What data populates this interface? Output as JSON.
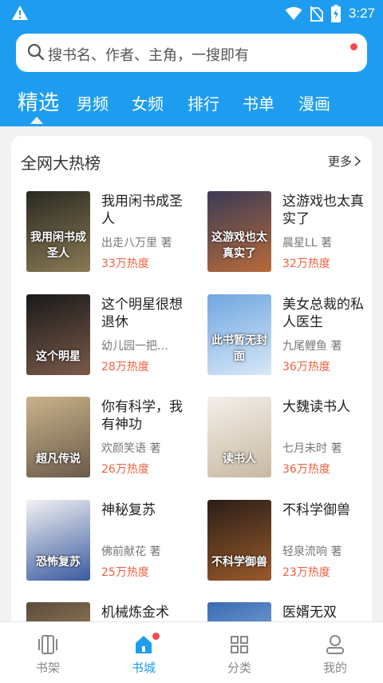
{
  "status": {
    "time": "3:27"
  },
  "search": {
    "placeholder": "搜书名、作者、主角，一搜即有"
  },
  "tabs": [
    {
      "label": "精选"
    },
    {
      "label": "男频"
    },
    {
      "label": "女频"
    },
    {
      "label": "排行"
    },
    {
      "label": "书单"
    },
    {
      "label": "漫画"
    }
  ],
  "section": {
    "title": "全网大热榜",
    "more": "更多"
  },
  "books": [
    {
      "title": "我用闲书成圣人",
      "author": "出走八万里 著",
      "heat": "33万热度",
      "cover_text": "我用闲书成圣人",
      "cover_colors": [
        "#2a2a22",
        "#8a7a55"
      ]
    },
    {
      "title": "这游戏也太真实了",
      "author": "晨星LL 著",
      "heat": "32万热度",
      "cover_text": "这游戏也太真实了",
      "cover_colors": [
        "#3b3b55",
        "#b86a3a"
      ]
    },
    {
      "title": "这个明星很想退休",
      "author": "幼儿园一把…",
      "heat": "28万热度",
      "cover_text": "这个明星",
      "cover_colors": [
        "#1a1a1a",
        "#7a5a4a"
      ]
    },
    {
      "title": "美女总裁的私人医生",
      "author": "九尾鲤鱼 著",
      "heat": "36万热度",
      "cover_text": "此书暂无封面",
      "cover_colors": [
        "#6fa6e0",
        "#d8e8f8"
      ]
    },
    {
      "title": "你有科学，我有神功",
      "author": "欢颜笑语 著",
      "heat": "26万热度",
      "cover_text": "超凡传说",
      "cover_colors": [
        "#c9b38a",
        "#6a5a4a"
      ]
    },
    {
      "title": "大魏读书人",
      "author": "七月未时 著",
      "heat": "36万热度",
      "cover_text": "读书人",
      "cover_colors": [
        "#f4f0ea",
        "#c8b8a0"
      ]
    },
    {
      "title": "神秘复苏",
      "author": "佛前献花 著",
      "heat": "25万热度",
      "cover_text": "恐怖复苏",
      "cover_colors": [
        "#f2f2f2",
        "#3a5aa0"
      ]
    },
    {
      "title": "不科学御兽",
      "author": "轻泉流响 著",
      "heat": "23万热度",
      "cover_text": "不科学御兽",
      "cover_colors": [
        "#2a1e18",
        "#9a5a2a"
      ]
    },
    {
      "title": "机械炼金术",
      "author": "",
      "heat": "",
      "cover_text": "",
      "cover_colors": [
        "#5a4a3a",
        "#c0a070"
      ]
    },
    {
      "title": "医婿无双",
      "author": "",
      "heat": "",
      "cover_text": "",
      "cover_colors": [
        "#3a6ab0",
        "#a0c8f0"
      ]
    }
  ],
  "bottom_nav": [
    {
      "label": "书架",
      "icon": "bookshelf-icon"
    },
    {
      "label": "书城",
      "icon": "bookstore-home-icon"
    },
    {
      "label": "分类",
      "icon": "category-grid-icon"
    },
    {
      "label": "我的",
      "icon": "profile-icon"
    }
  ],
  "colors": {
    "brand": "#1e9df0",
    "heat": "#f06040",
    "badge": "#f04a4a"
  }
}
